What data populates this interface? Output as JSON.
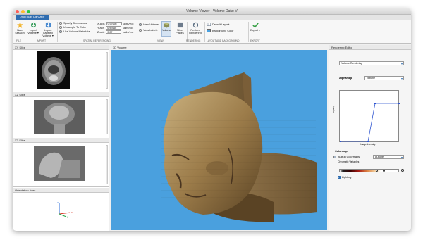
{
  "window": {
    "title": "Volume Viewer - Volume Data: V",
    "lights": [
      "#ff5f57",
      "#febc2e",
      "#28c840"
    ]
  },
  "tabstrip": {
    "active_tab": "VOLUME VIEWER"
  },
  "toolstrip": {
    "file": {
      "new_session": "New Session",
      "group": "FILE"
    },
    "import": {
      "import_volume": "Import Volume ▾",
      "import_labeled": "Import Labeled Volume ▾",
      "group": "IMPORT"
    },
    "spatial": {
      "specify_dims": "Specify Dimensions",
      "upsample": "Upsample To Cube",
      "use_metadata": "Use Volume Metadata",
      "x_label": "X-axis",
      "y_label": "Y-axis",
      "z_label": "Z-axis",
      "x_value": "0.97656",
      "y_value": "0.97656",
      "z_value": "3.27",
      "units": "units/vox",
      "group": "SPATIAL REFERENCING"
    },
    "view": {
      "view_volume": "View Volume",
      "view_labels": "View Labels",
      "volume_btn": "Volume",
      "slice_planes": "Slice Planes",
      "group": "VIEW"
    },
    "rendering": {
      "restore": "Restore Rendering",
      "group": "RENDERING"
    },
    "layout": {
      "default_layout": "Default Layout",
      "bg_color": "Background Color",
      "group": "LAYOUT AND BACKGROUND"
    },
    "export": {
      "label": "Export ▾",
      "group": "EXPORT"
    }
  },
  "left_panels": {
    "xy": "XY Slice",
    "xz": "XZ Slice",
    "yz": "YZ Slice",
    "orient": "Orientation Axes"
  },
  "center": {
    "tab": "3D Volume"
  },
  "right": {
    "tab": "Rendering Editor",
    "mode": "Volume Rendering",
    "alphamap_label": "Alphamap",
    "alphamap_value": "ct-bone",
    "y_axis": "Opacity",
    "x_axis": "Image Intensity",
    "colormap_label": "Colormap",
    "builtin_label": "Built-in Colormaps",
    "builtin_value": "ct-bone",
    "chromatic_label": "Chromatic Variables",
    "lighting_label": "Lighting"
  }
}
